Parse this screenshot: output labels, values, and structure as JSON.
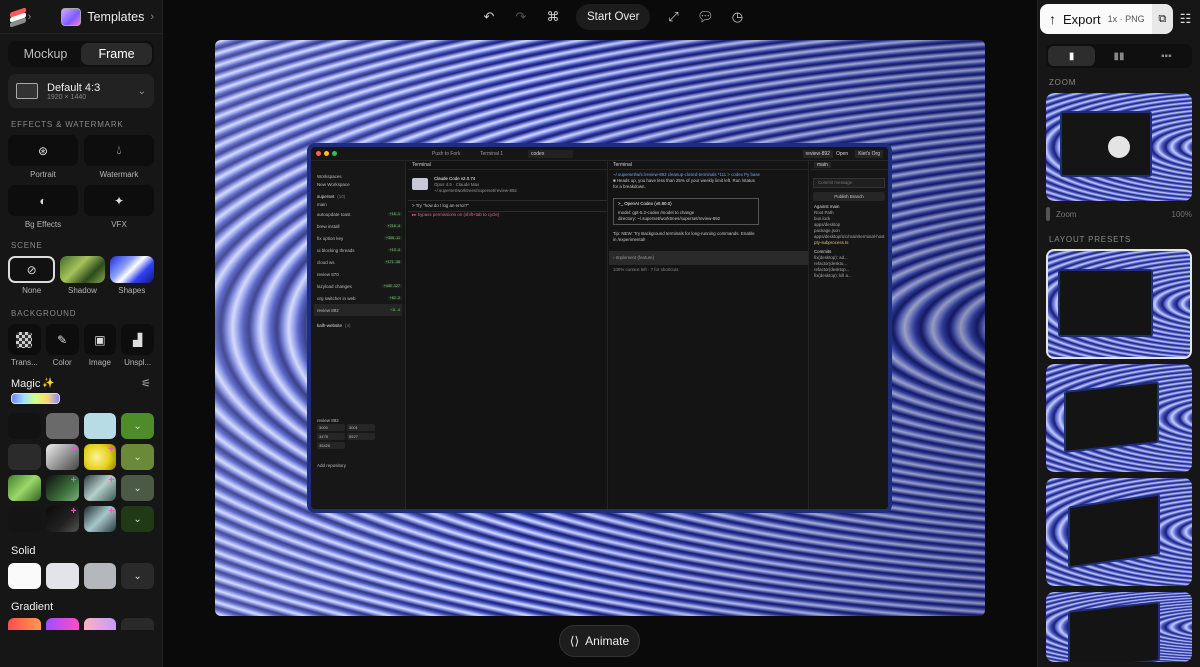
{
  "app": {
    "templates_label": "Templates"
  },
  "left": {
    "tabs": [
      "Mockup",
      "Frame"
    ],
    "preset": {
      "name": "Default 4:3",
      "size": "1920 × 1440"
    },
    "effects_header": "EFFECTS & WATERMARK",
    "effects": [
      "Portrait",
      "Watermark",
      "Bg Effects",
      "VFX"
    ],
    "scene_header": "SCENE",
    "scene": [
      "None",
      "Shadow",
      "Shapes"
    ],
    "background_header": "BACKGROUND",
    "background": [
      "Trans...",
      "Color",
      "Image",
      "Unspl..."
    ],
    "magic_label": "Magic",
    "solid_label": "Solid",
    "gradient_label": "Gradient"
  },
  "toolbar": {
    "start_over": "Start Over"
  },
  "animate_label": "Animate",
  "right": {
    "export_label": "Export",
    "export_format": "1x · PNG",
    "zoom_header": "ZOOM",
    "zoom_label": "Zoom",
    "zoom_value": "100%",
    "layout_presets_header": "LAYOUT PRESETS"
  },
  "screen": {
    "tabs": [
      "Push to Fork",
      "Terminal 1",
      "codex"
    ],
    "branch": "review-892",
    "open_label": "Open",
    "org": "Kiet's Org",
    "sidebar": {
      "workspaces": "Workspaces",
      "new_workspace": "New Workspace",
      "repo": "superset",
      "repo_count": "(10)",
      "items": [
        {
          "name": "main",
          "badge": ""
        },
        {
          "name": "autoupdate toast",
          "badge": "+16 -1"
        },
        {
          "name": "brew install",
          "badge": "+216 -4"
        },
        {
          "name": "fix option key",
          "badge": "+306 -11"
        },
        {
          "name": "ui blocking threads",
          "badge": "+10 -4"
        },
        {
          "name": "cloud ws",
          "badge": "+171 -36"
        },
        {
          "name": "review 870",
          "badge": ""
        },
        {
          "name": "lazyload changes",
          "badge": "+440 -127"
        },
        {
          "name": "org switcher in web",
          "badge": "+82 -3"
        },
        {
          "name": "review 892",
          "badge": "+11 -4"
        }
      ],
      "other_repo": "kalh-website",
      "other_count": "(4)",
      "ports_label": "review 892",
      "ports": [
        "3000",
        "3001",
        "3478",
        "5927",
        "35426"
      ],
      "add_repo": "Add repository"
    },
    "pane1": {
      "title": "Terminal",
      "claude": "Claude Code v2.0.74",
      "model": "Opus 4.5 · Claude Max",
      "path": "~/.superset/worktrees/superset/review-892",
      "prompt": "> Try \"how do I log an error?\"",
      "bypass": "▸▸ bypass permissions on (shift+tab to cycle)"
    },
    "pane2": {
      "title": "Terminal",
      "line1": "~/.superset/w/s:/review-892 cleanup-closed-terminals *111 > codex Py base",
      "line2": "■ Heads up, you have less than 25% of your weekly limit left. Run /status",
      "line3": "  for a breakdown.",
      "codex_title": ">_ OpenAI Codex (v0.80.0)",
      "model_line": "model:     gpt-5.2-codex   /model to change",
      "dir_line": "directory: ~/.superset/worktrees/superset/review-892",
      "tip": "Tip: NEW: Try Background terminals for long-running commands. Enable",
      "tip2": "in /experimental!",
      "implement": "› Implement {feature}",
      "context": "100% context left · ? for shortcuts"
    },
    "pane3": {
      "base": "main",
      "commit_msg": "Commit message",
      "publish": "Publish Branch",
      "against": "Against main",
      "files": [
        "Root Path",
        "bun.lock",
        "apps/desktop",
        "package.json",
        "apps/desktop/src/main/terminal-host",
        "pty-subprocess.ts"
      ],
      "commits_label": "Commits",
      "commits": [
        "fix(desktop): ad...",
        "refactor(deskto...",
        "refactor(desktop...",
        "fix(desktop): kill a..."
      ]
    }
  },
  "colors": {
    "accent": "#fafafa",
    "panel": "#161616",
    "bg": "#0a0a0a",
    "plus": "#ff4fd6"
  }
}
